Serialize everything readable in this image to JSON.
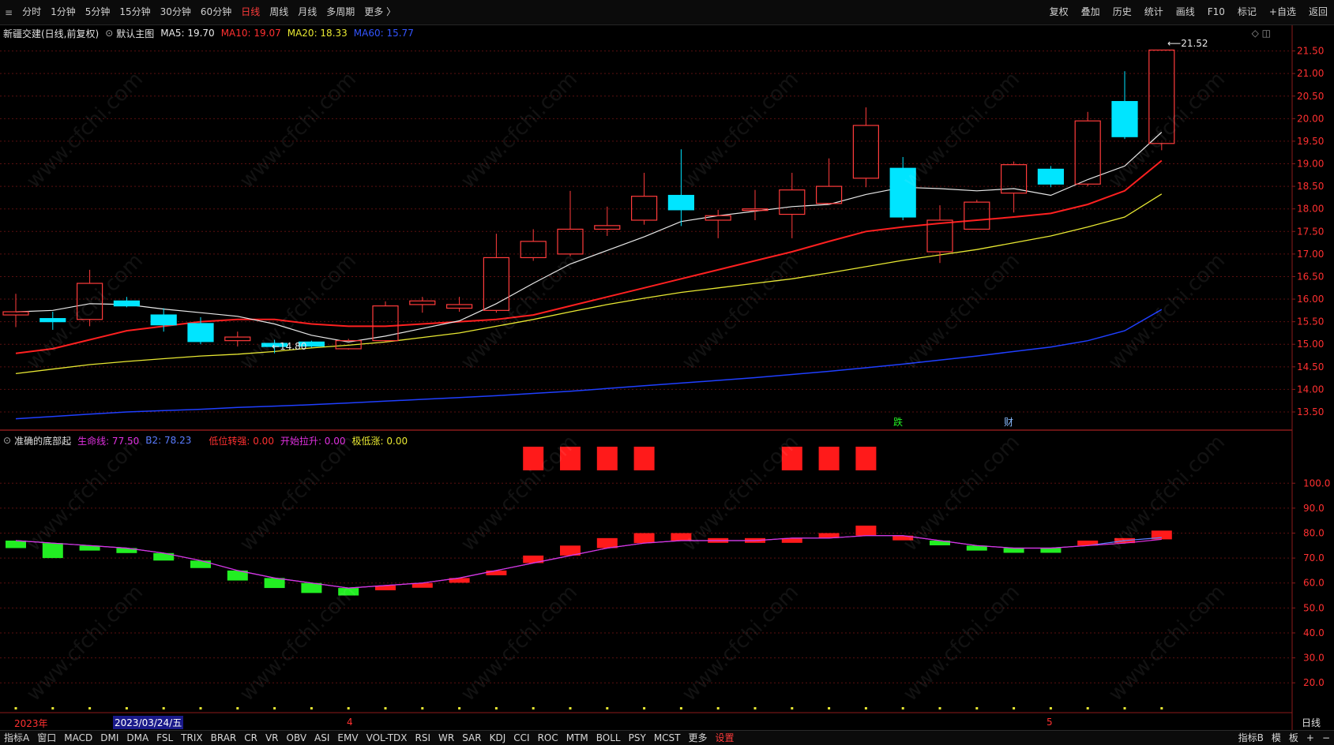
{
  "topbar": {
    "timeframes": [
      "分时",
      "1分钟",
      "5分钟",
      "15分钟",
      "30分钟",
      "60分钟",
      "日线",
      "周线",
      "月线",
      "多周期",
      "更多 〉"
    ],
    "active_timeframe": "日线",
    "right_tools": [
      "复权",
      "叠加",
      "历史",
      "统计",
      "画线",
      "F10",
      "标记",
      "+自选",
      "返回"
    ]
  },
  "infobar": {
    "title": "新疆交建(日线,前复权)",
    "main_chart_label": "默认主图",
    "ma5": "MA5: 19.70",
    "ma10": "MA10: 19.07",
    "ma20": "MA20: 18.33",
    "ma60": "MA60: 15.77"
  },
  "indicator": {
    "name": "准确的底部起",
    "life_line": "生命线: 77.50",
    "b2": "B2: 78.23",
    "low_turn": "低位转强: 0.00",
    "open_up": "开始拉升: 0.00",
    "extreme_low": "极低涨: 0.00"
  },
  "annotations": {
    "high_label": "21.52",
    "low_label": "←14.80",
    "event_fall": "跌",
    "event_finance": "财"
  },
  "x_axis": {
    "year": "2023年",
    "cursor_date": "2023/03/24/五",
    "month_4": "4",
    "month_5": "5"
  },
  "bottombar": {
    "left_tabs": [
      "指标A",
      "窗口",
      "MACD",
      "DMI",
      "DMA",
      "FSL",
      "TRIX",
      "BRAR",
      "CR",
      "VR",
      "OBV",
      "ASI",
      "EMV",
      "VOL-TDX",
      "RSI",
      "WR",
      "SAR",
      "KDJ",
      "CCI",
      "ROC",
      "MTM",
      "BOLL",
      "PSY",
      "MCST",
      "更多",
      "设置"
    ],
    "right_tabs": [
      "指标B",
      "模",
      "板",
      "+",
      "−"
    ],
    "period_label": "日线"
  },
  "colors": {
    "up": "#ff3b3b",
    "down": "#00e5ff",
    "ma5": "#e8e8e8",
    "ma10": "#ff2020",
    "ma20": "#e8e832",
    "ma60": "#1f3fff",
    "ind_up": "#ff1a1a",
    "ind_down": "#22ee22",
    "life": "#e030e0",
    "b2": "#5a7cff",
    "dots": "#e8e832"
  },
  "chart_data": {
    "type": "candlestick",
    "price_axis_ticks": [
      "21.50",
      "21.00",
      "20.50",
      "20.00",
      "19.50",
      "19.00",
      "18.50",
      "18.00",
      "17.50",
      "17.00",
      "16.50",
      "16.00",
      "15.50",
      "15.00",
      "14.50",
      "14.00",
      "13.50"
    ],
    "indicator_axis_ticks": [
      "100.0",
      "90.0",
      "80.0",
      "70.0",
      "60.0",
      "50.0",
      "40.0",
      "30.0",
      "20.0"
    ],
    "candles": [
      {
        "o": 15.65,
        "h": 16.12,
        "l": 15.38,
        "c": 15.72
      },
      {
        "o": 15.57,
        "h": 15.72,
        "l": 15.32,
        "c": 15.5
      },
      {
        "o": 15.55,
        "h": 16.65,
        "l": 15.4,
        "c": 16.35
      },
      {
        "o": 15.96,
        "h": 16.05,
        "l": 15.82,
        "c": 15.85
      },
      {
        "o": 15.65,
        "h": 15.8,
        "l": 15.28,
        "c": 15.43
      },
      {
        "o": 15.46,
        "h": 15.6,
        "l": 15.0,
        "c": 15.06
      },
      {
        "o": 15.08,
        "h": 15.28,
        "l": 14.95,
        "c": 15.16
      },
      {
        "o": 15.02,
        "h": 15.1,
        "l": 14.8,
        "c": 14.95
      },
      {
        "o": 15.05,
        "h": 15.08,
        "l": 14.93,
        "c": 14.96
      },
      {
        "o": 14.9,
        "h": 15.12,
        "l": 14.88,
        "c": 15.08
      },
      {
        "o": 15.08,
        "h": 15.95,
        "l": 15.05,
        "c": 15.85
      },
      {
        "o": 15.88,
        "h": 16.05,
        "l": 15.7,
        "c": 15.96
      },
      {
        "o": 15.8,
        "h": 16.05,
        "l": 15.72,
        "c": 15.88
      },
      {
        "o": 15.75,
        "h": 17.45,
        "l": 15.7,
        "c": 16.92
      },
      {
        "o": 16.92,
        "h": 17.55,
        "l": 16.85,
        "c": 17.28
      },
      {
        "o": 17.0,
        "h": 18.4,
        "l": 16.95,
        "c": 17.55
      },
      {
        "o": 17.55,
        "h": 18.05,
        "l": 17.4,
        "c": 17.63
      },
      {
        "o": 17.75,
        "h": 18.8,
        "l": 17.65,
        "c": 18.28
      },
      {
        "o": 18.3,
        "h": 19.32,
        "l": 17.62,
        "c": 17.98
      },
      {
        "o": 17.75,
        "h": 17.98,
        "l": 17.35,
        "c": 17.85
      },
      {
        "o": 17.98,
        "h": 18.42,
        "l": 17.75,
        "c": 18.0
      },
      {
        "o": 17.88,
        "h": 18.8,
        "l": 17.35,
        "c": 18.42
      },
      {
        "o": 18.12,
        "h": 19.12,
        "l": 18.1,
        "c": 18.5
      },
      {
        "o": 18.68,
        "h": 20.25,
        "l": 18.48,
        "c": 19.85
      },
      {
        "o": 18.9,
        "h": 19.15,
        "l": 17.75,
        "c": 17.82
      },
      {
        "o": 17.05,
        "h": 18.08,
        "l": 16.8,
        "c": 17.75
      },
      {
        "o": 17.55,
        "h": 18.2,
        "l": 17.55,
        "c": 18.15
      },
      {
        "o": 18.35,
        "h": 19.05,
        "l": 17.92,
        "c": 18.98
      },
      {
        "o": 18.88,
        "h": 18.95,
        "l": 18.48,
        "c": 18.55
      },
      {
        "o": 18.55,
        "h": 20.15,
        "l": 18.5,
        "c": 19.95
      },
      {
        "o": 20.38,
        "h": 21.05,
        "l": 19.55,
        "c": 19.6
      },
      {
        "o": 19.45,
        "h": 21.52,
        "l": 19.3,
        "c": 21.52
      }
    ],
    "ma5": [
      15.72,
      15.75,
      15.9,
      15.88,
      15.78,
      15.7,
      15.62,
      15.45,
      15.2,
      15.05,
      15.18,
      15.35,
      15.52,
      15.9,
      16.35,
      16.78,
      17.08,
      17.38,
      17.72,
      17.85,
      17.95,
      18.05,
      18.1,
      18.32,
      18.48,
      18.45,
      18.4,
      18.45,
      18.3,
      18.65,
      18.95,
      19.7
    ],
    "ma10": [
      14.8,
      14.9,
      15.1,
      15.3,
      15.4,
      15.5,
      15.55,
      15.55,
      15.45,
      15.4,
      15.4,
      15.45,
      15.5,
      15.55,
      15.65,
      15.85,
      16.05,
      16.25,
      16.45,
      16.65,
      16.85,
      17.05,
      17.28,
      17.5,
      17.6,
      17.68,
      17.75,
      17.82,
      17.9,
      18.1,
      18.4,
      19.07
    ],
    "ma20": [
      14.35,
      14.45,
      14.55,
      14.62,
      14.68,
      14.74,
      14.78,
      14.84,
      14.92,
      14.98,
      15.05,
      15.15,
      15.25,
      15.4,
      15.55,
      15.72,
      15.88,
      16.02,
      16.15,
      16.25,
      16.35,
      16.45,
      16.58,
      16.72,
      16.86,
      16.98,
      17.1,
      17.25,
      17.4,
      17.6,
      17.82,
      18.33
    ],
    "ma60": [
      13.35,
      13.4,
      13.45,
      13.5,
      13.53,
      13.56,
      13.6,
      13.63,
      13.66,
      13.7,
      13.74,
      13.78,
      13.82,
      13.86,
      13.91,
      13.96,
      14.02,
      14.08,
      14.14,
      14.2,
      14.26,
      14.33,
      14.4,
      14.48,
      14.56,
      14.65,
      14.74,
      14.84,
      14.94,
      15.08,
      15.3,
      15.77
    ],
    "indicator": {
      "values": [
        74,
        70,
        73,
        72,
        69,
        66,
        61,
        58,
        56,
        55,
        59,
        60,
        62,
        65,
        71,
        75,
        78,
        80,
        80,
        78,
        78,
        78,
        80,
        83,
        79,
        76,
        73,
        73,
        73,
        77,
        78,
        81
      ],
      "life": [
        77,
        76,
        75,
        74,
        72,
        69,
        65,
        62,
        60,
        58,
        59,
        60,
        62,
        65,
        68,
        71,
        74,
        76,
        77,
        77,
        77,
        78,
        78,
        79,
        79,
        77,
        75,
        74,
        74,
        75,
        76,
        77.5
      ],
      "b2": [
        77,
        76,
        75,
        74,
        72,
        69,
        65,
        62,
        60,
        58,
        59,
        60,
        62,
        65,
        68,
        71,
        74,
        76,
        77,
        77,
        77,
        78,
        78,
        79,
        79,
        77,
        75,
        74,
        74,
        75,
        77,
        78.23
      ],
      "signal_blocks": [
        14,
        15,
        16,
        17,
        21,
        22,
        23
      ]
    }
  }
}
